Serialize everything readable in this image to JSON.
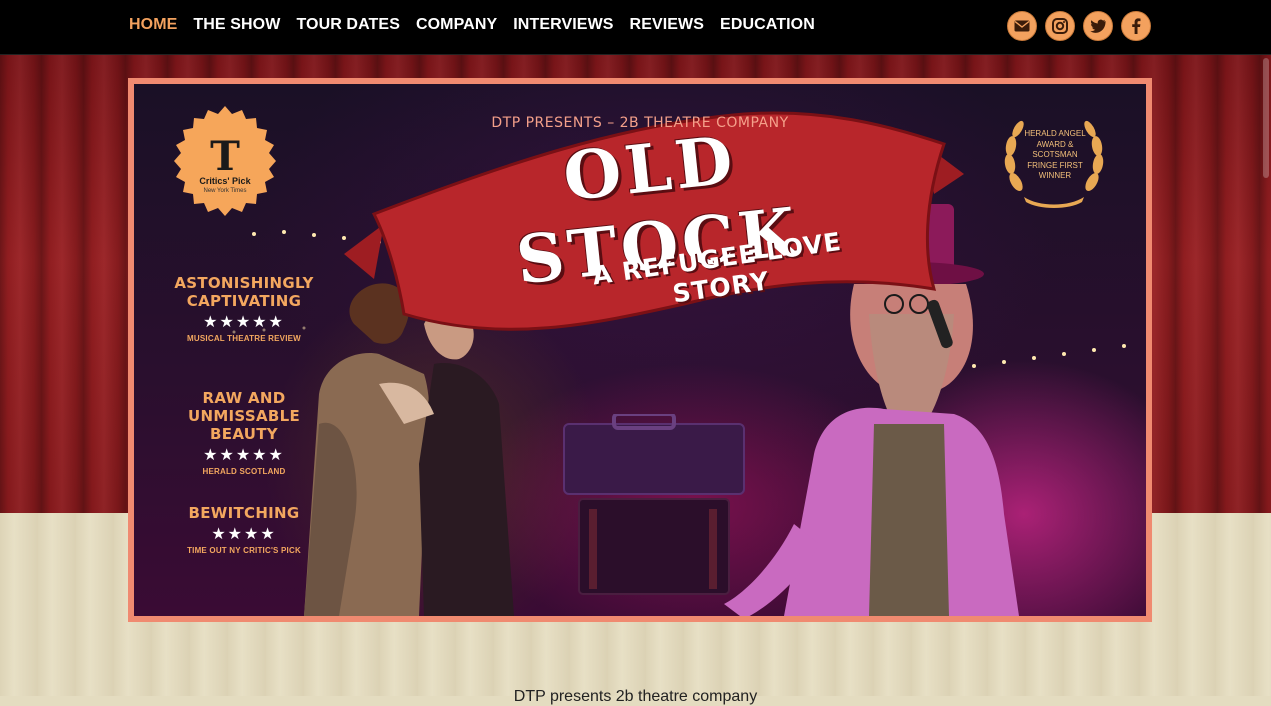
{
  "nav": {
    "links": [
      "HOME",
      "THE SHOW",
      "TOUR DATES",
      "COMPANY",
      "INTERVIEWS",
      "REVIEWS",
      "EDUCATION"
    ],
    "active": "HOME",
    "social_icons": [
      "email-icon",
      "instagram-icon",
      "twitter-icon",
      "facebook-icon"
    ]
  },
  "hero": {
    "presents": "DTP PRESENTS – 2B THEATRE COMPANY",
    "title": "OLD STOCK",
    "subtitle": "A REFUGEE LOVE STORY",
    "seal": {
      "letter": "T",
      "label": "Critics' Pick",
      "sub": "New York Times"
    },
    "award": "HERALD ANGEL AWARD & SCOTSMAN FRINGE FIRST WINNER",
    "reviews": [
      {
        "quote": "ASTONISHINGLY CAPTIVATING",
        "stars": "★★★★★",
        "source": "MUSICAL THEATRE REVIEW"
      },
      {
        "quote": "RAW AND UNMISSABLE BEAUTY",
        "stars": "★★★★★",
        "source": "HERALD SCOTLAND"
      },
      {
        "quote": "BEWITCHING",
        "stars": "★★★★",
        "source": "TIME OUT NY CRITIC'S PICK"
      }
    ]
  },
  "intro_text": "DTP presents 2b theatre company",
  "colors": {
    "accent": "#f3a15e",
    "frame": "#f08a70",
    "curtain": "#981f22",
    "floor": "#e6dec2"
  }
}
